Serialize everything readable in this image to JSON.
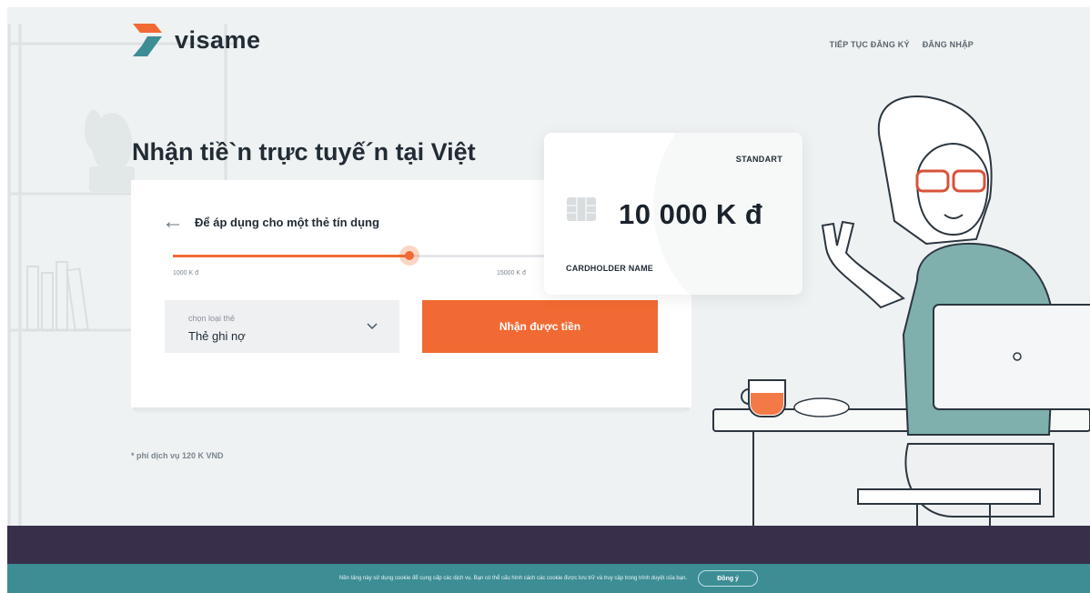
{
  "brand": {
    "name": "visame",
    "accent": "#f26a33",
    "teal": "#3d8d95",
    "dark": "#38304a"
  },
  "nav": {
    "items": [
      "TIẾP TỤC ĐĂNG KÝ",
      "ĐĂNG NHẬP"
    ]
  },
  "hero": {
    "title": "Nhận tiề`n trực tuyế´n tại Việt"
  },
  "form": {
    "back_icon": "arrow-left-icon",
    "title": "Để áp dụng cho một thẻ tín dụng",
    "slider": {
      "min_label": "1000 K đ",
      "max_label": "15000 K đ",
      "value_fraction": 0.62
    },
    "select": {
      "label": "chọn loại thẻ",
      "value": "Thẻ ghi nợ",
      "icon": "chevron-down-icon"
    },
    "cta_label": "Nhận được tiền"
  },
  "footnote": "* phí dịch vụ 120 K VND",
  "card": {
    "tier": "STANDART",
    "amount": "10 000 K đ",
    "holder": "CARDHOLDER NAME",
    "chip_icon": "card-chip-icon"
  },
  "cookie": {
    "text": "Nền tảng này sử dụng cookie để cung cấp các dịch vụ. Bạn có thể cấu hình cách các cookie được lưu trữ và truy cập trong trình duyệt của bạn.",
    "button": "Đồng ý"
  }
}
